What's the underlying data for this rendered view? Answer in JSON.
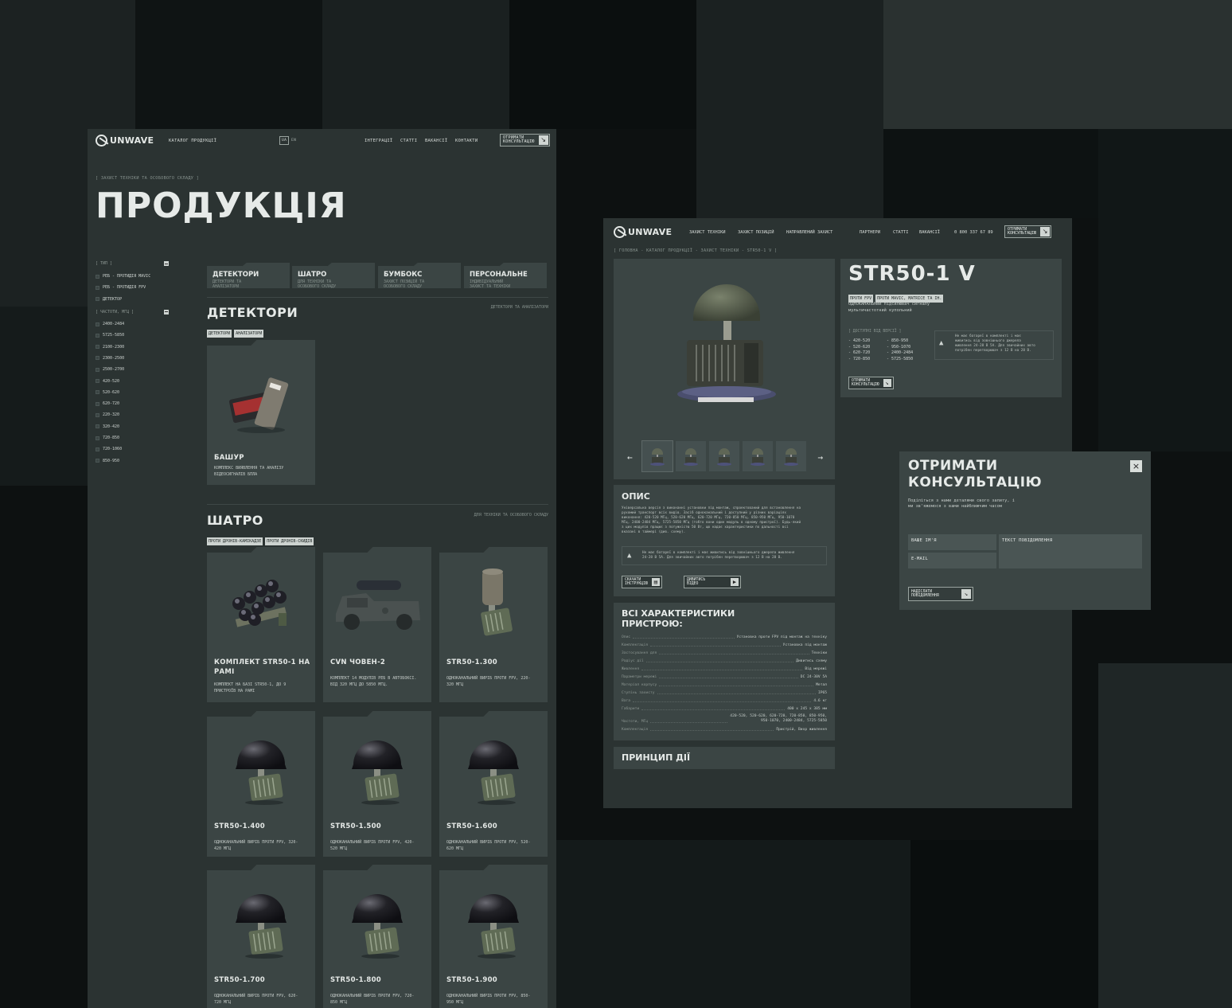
{
  "left_page": {
    "header": {
      "logo": "UNWAVE",
      "nav_catalog": "КАТАЛОГ ПРОДУКЦІЇ",
      "lang_ua": "UA",
      "lang_en": "EN",
      "nav": [
        "ІНТЕГРАЦІЇ",
        "СТАТТІ",
        "ВАКАНСІЇ",
        "КОНТАКТИ"
      ],
      "cta_line1": "ОТРИМАТИ",
      "cta_line2": "КОНСУЛЬТАЦІЮ"
    },
    "breadcrumb": "[ ЗАХИСТ ТЕХНІКИ ТА ОСОБОВОГО СКЛАДУ ]",
    "title": "ПРОДУКЦІЯ",
    "filters": {
      "type_label": "[ ТИП ]",
      "type_items": [
        "РЕБ - ПРОТИДІЯ MAVIC",
        "РЕБ - ПРОТИДІЯ FPV",
        "ДЕТЕКТОР"
      ],
      "freq_label": "[ ЧАСТОТИ, МГЦ ]",
      "freq_items": [
        "2400-2484",
        "5725-5850",
        "2100-2300",
        "2300-2500",
        "2500-2700",
        "420-520",
        "520-620",
        "620-720",
        "220-320",
        "320-420",
        "720-850",
        "720-1060",
        "850-950"
      ]
    },
    "category_tabs": [
      {
        "title": "ДЕТЕКТОРИ",
        "sub1": "ДЕТЕКТОРИ ТА",
        "sub2": "АНАЛІЗАТОРИ"
      },
      {
        "title": "ШАТРО",
        "sub1": "ДЛЯ ТЕХНІКИ ТА",
        "sub2": "ОСОБОВОГО СКЛАДУ"
      },
      {
        "title": "БУМБОКС",
        "sub1": "ЗАХИСТ ПОЗИЦІЙ ТА",
        "sub2": "ОСОБОВОГО СКЛАДУ"
      },
      {
        "title": "ПЕРСОНАЛЬНЕ",
        "sub1": "ІНДИВІДУАЛЬНИЙ",
        "sub2": "ЗАХИСТ ТА ТЕХНІКИ"
      }
    ],
    "section_detectors": {
      "title": "ДЕТЕКТОРИ",
      "subtitle": "ДЕТЕКТОРИ ТА АНАЛІЗАТОРИ",
      "chips": [
        "ДЕТЕКТОРИ",
        "АНАЛІЗАТОРИ"
      ],
      "product": {
        "name": "БАШУР",
        "desc1": "КОМПЛЕКС ВИЯВЛЕННЯ ТА АНАЛІЗУ",
        "desc2": "ВІДЕОСИГНАЛІВ БПЛА"
      }
    },
    "section_shatro": {
      "title": "ШАТРО",
      "subtitle": "ДЛЯ ТЕХНІКИ ТА ОСОБОВОГО СКЛАДУ",
      "chips": [
        "ПРОТИ ДРОНІВ-КАМІКАДЗЕ",
        "ПРОТИ ДРОНІВ-СКИДІВ"
      ],
      "products": [
        {
          "name1": "КОМПЛЕКТ STR50-1 НА",
          "name2": "РАМІ",
          "desc1": "КОМПЛЕКТ НА БАЗІ STR50-1, ДО 9",
          "desc2": "ПРИСТРОЇВ НА РАМІ"
        },
        {
          "name1": "CVN ЧОВЕН-2",
          "name2": "",
          "desc1": "КОМПЛЕКТ 14 МОДУЛІВ РЕБ В АВТОБОКСІ.",
          "desc2": "ВІД 320 МГЦ ДО 5850 МГЦ."
        },
        {
          "name1": "STR50-1.300",
          "name2": "",
          "desc1": "ОДНОКАНАЛЬНИЙ ВИРІБ ПРОТИ FPV, 220-",
          "desc2": "320 МГЦ"
        },
        {
          "name1": "STR50-1.400",
          "name2": "",
          "desc1": "ОДНОКАНАЛЬНИЙ ВИРІБ ПРОТИ FPV, 320-",
          "desc2": "420 МГЦ"
        },
        {
          "name1": "STR50-1.500",
          "name2": "",
          "desc1": "ОДНОКАНАЛЬНИЙ ВИРІБ ПРОТИ FPV, 420-",
          "desc2": "520 МГЦ"
        },
        {
          "name1": "STR50-1.600",
          "name2": "",
          "desc1": "ОДНОКАНАЛЬНИЙ ВИРІБ ПРОТИ FPV, 520-",
          "desc2": "620 МГЦ"
        },
        {
          "name1": "STR50-1.700",
          "name2": "",
          "desc1": "ОДНОКАНАЛЬНИЙ ВИРІБ ПРОТИ FPV, 620-",
          "desc2": "720 МГЦ"
        },
        {
          "name1": "STR50-1.800",
          "name2": "",
          "desc1": "ОДНОКАНАЛЬНИЙ ВИРІБ ПРОТИ FPV, 720-",
          "desc2": "850 МГЦ"
        },
        {
          "name1": "STR50-1.900",
          "name2": "",
          "desc1": "ОДНОКАНАЛЬНИЙ ВИРІБ ПРОТИ FPV, 850-",
          "desc2": "950 МГЦ"
        }
      ]
    }
  },
  "right_page": {
    "header": {
      "logo": "UNWAVE",
      "nav": [
        "ЗАХИСТ ТЕХНІКИ",
        "ЗАХИСТ ПОЗИЦІЙ",
        "НАПРАВЛЕНИЙ ЗАХИСТ",
        "ПАРТНЕРИ",
        "СТАТТІ",
        "ВАКАНСІЇ"
      ],
      "phone": "0 800 337 67 89",
      "cta_line1": "ОТРИМАТИ",
      "cta_line2": "КОНСУЛЬТАЦІЮ"
    },
    "breadcrumb": "[ ГОЛОВНА - КАТАЛОГ ПРОДУКЦІЇ - ЗАХИСТ ТЕХНІКИ - STR50-1 V ]",
    "product": {
      "title": "STR50-1 V",
      "chips": [
        "ПРОТИ FPV",
        "ПРОТИ MAVIC, MATRICE ТА ІН."
      ],
      "tagline1": "ОДНОКАНАЛЬНИЙ підсилювач сигналу",
      "tagline2": "мультичастотний купольний",
      "versions_label": "[ ДОСТУПНІ ВІД ВЕРСІЇ ]",
      "versions_col1": [
        "- 420-520",
        "- 520-620",
        "- 620-720",
        "- 720-850"
      ],
      "versions_col2": [
        "- 850-950",
        "- 950-1070",
        "- 2400-2484",
        "- 5725-5850"
      ],
      "battery_note1": "Не має батареї в комплекті і має",
      "battery_note2": "живитись від зовнішнього джерела",
      "battery_note3": "живлення 24-28 В 5А. Для звичайних авто",
      "battery_note4": "потрібен перетворювач з 12 В на 28 В.",
      "cta_line1": "ОТРИМАТИ",
      "cta_line2": "КОНСУЛЬТАЦІЮ"
    },
    "gallery": {
      "prev": "←",
      "next": "→"
    },
    "description": {
      "title": "ОПИС",
      "text": [
        "Універсальна версія з виконанні установки під монтаж, спроектований для встановлення на",
        "рухомий транспорт всіх видів. Засіб одноканальний і доступний у різних варіаціях",
        "виконання: 420-520 МГц, 520-620 МГц, 620-720 МГц, 720-850 МГц, 850-950 МГц, 950-1070",
        "МГц, 2400-2484 МГц, 5725-5850 МГц (тобто вони один модуль в одному пристрої). Будь-який",
        "з цих модулів працює з потужністю 50 Вт, що надає характеристики по дальності всі",
        "вказані в таймері (див. схему)."
      ],
      "warn1": "Не має батареї в комплекті і має живитись від зовнішнього джерела живлення",
      "warn2": "24-28 В 5А. Для звичайних авто потрібен перетворювач з 12 В на 28 В.",
      "btn_manual1": "СКАЧАТИ",
      "btn_manual2": "ІНСТРУКЦІЮ",
      "btn_video1": "ДИВИТИСЬ",
      "btn_video2": "ВІДЕО"
    },
    "specs": {
      "title1": "ВСІ ХАРАКТЕРИСТИКИ",
      "title2": "ПРИСТРОЮ:",
      "rows": [
        {
          "k": "Опис",
          "v": "Установка проти FPV під монтаж на техніку"
        },
        {
          "k": "Комплектація",
          "v": "Установка під монтаж"
        },
        {
          "k": "Застосування для",
          "v": "Техніки"
        },
        {
          "k": "Радіус дії",
          "v": "Дивитись схему"
        },
        {
          "k": "Живлення",
          "v": "Від мережі"
        },
        {
          "k": "Параметри мережі",
          "v": "DC 24-30V 5A"
        },
        {
          "k": "Матеріал корпусу",
          "v": "Метал"
        },
        {
          "k": "Ступінь захисту",
          "v": "IP65"
        },
        {
          "k": "Вага",
          "v": "4.6 кг"
        },
        {
          "k": "Габарити",
          "v": "400 x 245 x 385 мм"
        }
      ],
      "freq_key": "Частоти, МГц",
      "freq_val1": "420-520, 520-620, 620-720, 720-850, 850-950,",
      "freq_val2": "950-1070, 2400-2484, 5725-5850",
      "last_key": "Комплектація",
      "last_val": "Пристрій, Вихр живлення"
    },
    "principle_title": "ПРИНЦИП ДІЇ"
  },
  "modal": {
    "title1": "ОТРИМАТИ",
    "title2": "КОНСУЛЬТАЦІЮ",
    "sub1": "Поділіться з нами деталями свого запиту, і",
    "sub2": "ми зв'яжемося з вами найближчим часом",
    "name_placeholder": "ВАШЕ ІМ'Я",
    "email_placeholder": "E-MAIL",
    "message_placeholder": "ТЕКСТ ПОВІДОМЛЕННЯ",
    "submit_line1": "НАДІСЛАТИ",
    "submit_line2": "ПОВІДОМЛЕННЯ",
    "close": "×"
  }
}
